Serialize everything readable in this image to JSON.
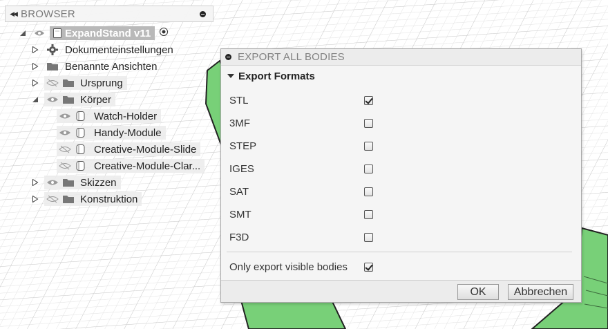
{
  "browser": {
    "title": "BROWSER",
    "root": {
      "label": "ExpandStand v11"
    },
    "items": [
      {
        "label": "Dokumenteinstellungen",
        "icon": "gear-icon"
      },
      {
        "label": "Benannte Ansichten",
        "icon": "folder-icon"
      },
      {
        "label": "Ursprung",
        "icon": "folder-icon",
        "visible": false
      },
      {
        "label": "Körper",
        "icon": "folder-icon",
        "visible": true,
        "expanded": true
      },
      {
        "label": "Watch-Holder",
        "icon": "body-icon",
        "visible": true
      },
      {
        "label": "Handy-Module",
        "icon": "body-icon",
        "visible": true
      },
      {
        "label": "Creative-Module-Slide",
        "icon": "body-icon",
        "visible": false
      },
      {
        "label": "Creative-Module-Clar...",
        "icon": "body-icon",
        "visible": false
      },
      {
        "label": "Skizzen",
        "icon": "folder-icon",
        "visible": true
      },
      {
        "label": "Konstruktion",
        "icon": "folder-icon",
        "visible": false
      }
    ]
  },
  "dialog": {
    "title": "EXPORT ALL BODIES",
    "section": "Export Formats",
    "formats": [
      {
        "label": "STL",
        "checked": true
      },
      {
        "label": "3MF",
        "checked": false
      },
      {
        "label": "STEP",
        "checked": false
      },
      {
        "label": "IGES",
        "checked": false
      },
      {
        "label": "SAT",
        "checked": false
      },
      {
        "label": "SMT",
        "checked": false
      },
      {
        "label": "F3D",
        "checked": false
      }
    ],
    "visible_only": {
      "label": "Only export visible bodies",
      "checked": true
    },
    "ok_label": "OK",
    "cancel_label": "Abbrechen"
  },
  "colors": {
    "model_green": "#78d078",
    "grid": "#d8d8d8",
    "accent_gray": "#b9b9b9"
  }
}
